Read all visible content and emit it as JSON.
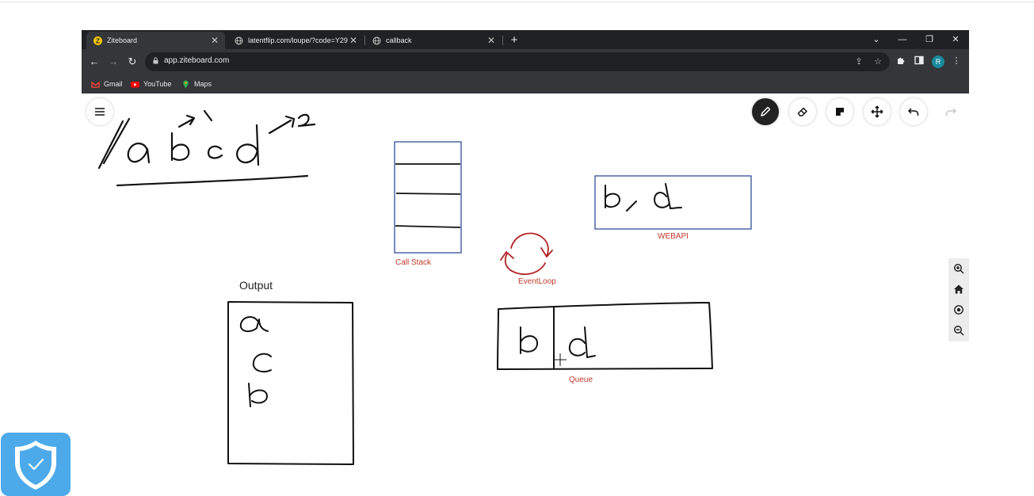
{
  "browser": {
    "tabs": [
      {
        "title": "Ziteboard",
        "active": true
      },
      {
        "title": "latentflip.com/loupe/?code=Y29",
        "active": false
      },
      {
        "title": "callback",
        "active": false
      }
    ],
    "url": "app.ziteboard.com",
    "avatar_initial": "R",
    "bookmarks": [
      {
        "label": "Gmail",
        "icon": "gmail-icon"
      },
      {
        "label": "YouTube",
        "icon": "youtube-icon"
      },
      {
        "label": "Maps",
        "icon": "maps-icon"
      }
    ]
  },
  "board": {
    "labels": {
      "call_stack": "Call Stack",
      "event_loop": "EventLoop",
      "webapi": "WEBAPI",
      "queue": "Queue",
      "output": "Output"
    },
    "tools": [
      "pen-icon",
      "eraser-icon",
      "sticky-note-icon",
      "move-icon",
      "undo-icon",
      "redo-icon"
    ],
    "zoom_controls": [
      "zoom-in-icon",
      "home-icon",
      "center-icon",
      "zoom-out-icon"
    ],
    "colors": {
      "accent_red": "#c0392b",
      "box_blue": "#1f3f8f",
      "ink": "#111111"
    }
  }
}
